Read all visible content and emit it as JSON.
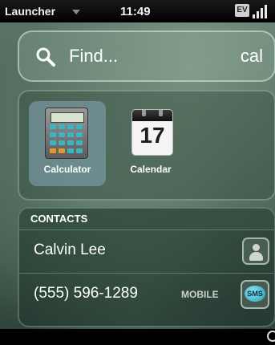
{
  "status_bar": {
    "app_menu_label": "Launcher",
    "time": "11:49",
    "network_badge": "EV",
    "icons": [
      "chevron-down-icon",
      "ev-network-icon",
      "signal-strength-icon"
    ]
  },
  "search": {
    "placeholder": "Find...",
    "query": "cal",
    "icon": "search-icon"
  },
  "apps": [
    {
      "label": "Calculator",
      "icon": "calculator-icon",
      "selected": true
    },
    {
      "label": "Calendar",
      "icon": "calendar-icon",
      "day": "17",
      "selected": false
    }
  ],
  "contacts": {
    "header": "CONTACTS",
    "items": [
      {
        "name": "Calvin Lee",
        "icon": "person-icon"
      },
      {
        "phone": "(555) 596-1289",
        "type": "MOBILE",
        "icon": "sms-icon",
        "icon_label": "SMS"
      }
    ]
  },
  "colors": {
    "highlight": "#6ba4e6",
    "selected_tile": "#87aab9",
    "background": "#4b6558"
  }
}
